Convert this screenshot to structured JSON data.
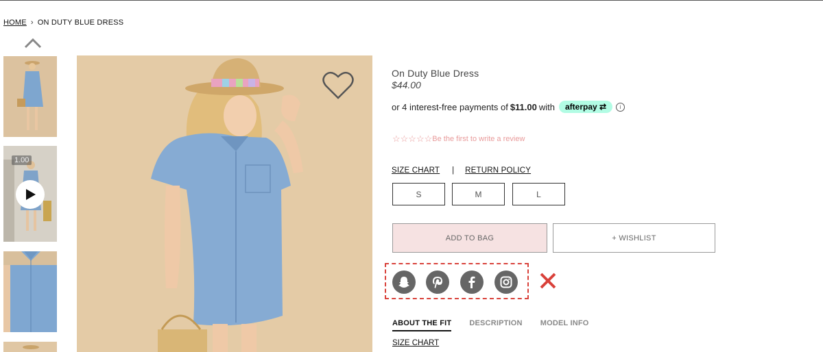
{
  "breadcrumb": {
    "home": "HOME",
    "separator": "›",
    "current": "ON DUTY BLUE DRESS"
  },
  "thumbnails": {
    "video_time": "1.00"
  },
  "product": {
    "title": "On Duty Blue Dress",
    "price": "$44.00"
  },
  "afterpay": {
    "prefix": "or 4 interest-free payments of",
    "amount": "$11.00",
    "suffix": "with",
    "badge": "afterpay",
    "info": "i"
  },
  "reviews": {
    "stars": "☆☆☆☆☆",
    "link": "Be the first to write a review"
  },
  "links": {
    "size_chart": "SIZE CHART",
    "divider": "|",
    "return_policy": "RETURN POLICY"
  },
  "sizes": [
    "S",
    "M",
    "L"
  ],
  "actions": {
    "add_to_bag": "ADD TO BAG",
    "wishlist": "+ WISHLIST"
  },
  "social": [
    "snapchat-icon",
    "pinterest-icon",
    "facebook-icon",
    "instagram-icon"
  ],
  "tabs": [
    {
      "label": "ABOUT THE FIT",
      "active": true
    },
    {
      "label": "DESCRIPTION",
      "active": false
    },
    {
      "label": "MODEL INFO",
      "active": false
    }
  ],
  "fit_section": {
    "size_chart": "SIZE CHART"
  },
  "colors": {
    "accent_pink": "#f6e2e2",
    "review_pink": "#e89a9a",
    "afterpay_mint": "#b2fce4",
    "annotation_red": "#d9413a"
  }
}
